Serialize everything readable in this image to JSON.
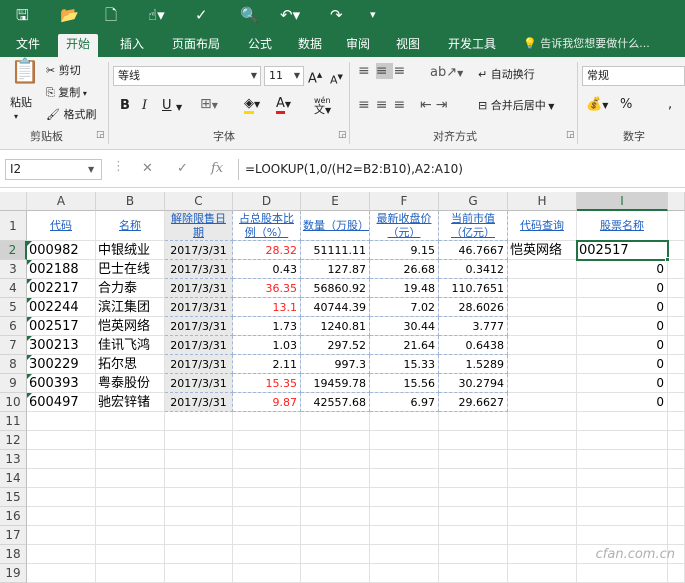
{
  "qat": {
    "icons": [
      "save-icon",
      "open-icon",
      "new-icon",
      "touch-icon",
      "spell-icon",
      "preview-icon",
      "undo-icon",
      "redo-icon",
      "customize-icon"
    ]
  },
  "tabs": [
    "文件",
    "开始",
    "插入",
    "页面布局",
    "公式",
    "数据",
    "审阅",
    "视图",
    "开发工具"
  ],
  "tellme": "告诉我您想要做什么...",
  "clipboard": {
    "cut": "剪切",
    "copy": "复制",
    "paste": "粘贴",
    "painter": "格式刷",
    "group": "剪贴板"
  },
  "font": {
    "name": "等线",
    "size": "11",
    "group": "字体",
    "bold": "B",
    "italic": "I",
    "underline": "U",
    "phonetic": "wén"
  },
  "alignment": {
    "wrap": "自动换行",
    "merge": "合并后居中",
    "group": "对齐方式"
  },
  "number": {
    "format": "常规",
    "group": "数字",
    "percent": "%"
  },
  "formula_bar": {
    "name_box": "I2",
    "fx": "fx",
    "formula": "=LOOKUP(1,0/(H2=B2:B10),A2:A10)"
  },
  "columns": [
    "A",
    "B",
    "C",
    "D",
    "E",
    "F",
    "G",
    "H",
    "I"
  ],
  "rows": [
    "1",
    "2",
    "3",
    "4",
    "5",
    "6",
    "7",
    "8",
    "9",
    "10",
    "11",
    "12",
    "13",
    "14",
    "15",
    "16",
    "17",
    "18",
    "19"
  ],
  "headers": [
    "代码",
    "名称",
    "解除限售日期",
    "占总股本比例（%）",
    "数量（万股）",
    "最新收盘价（元）",
    "当前市值（亿元）",
    "代码查询",
    "股票名称"
  ],
  "data": [
    [
      "000982",
      "中银绒业",
      "2017/3/31",
      "28.32",
      "51111.11",
      "9.15",
      "46.7667"
    ],
    [
      "002188",
      "巴士在线",
      "2017/3/31",
      "0.43",
      "127.87",
      "26.68",
      "0.3412"
    ],
    [
      "002217",
      "合力泰",
      "2017/3/31",
      "36.35",
      "56860.92",
      "19.48",
      "110.7651"
    ],
    [
      "002244",
      "滨江集团",
      "2017/3/31",
      "13.1",
      "40744.39",
      "7.02",
      "28.6026"
    ],
    [
      "002517",
      "恺英网络",
      "2017/3/31",
      "1.73",
      "1240.81",
      "30.44",
      "3.777"
    ],
    [
      "300213",
      "佳讯飞鸿",
      "2017/3/31",
      "1.03",
      "297.52",
      "21.64",
      "0.6438"
    ],
    [
      "300229",
      "拓尔思",
      "2017/3/31",
      "2.11",
      "997.3",
      "15.33",
      "1.5289"
    ],
    [
      "600393",
      "粤泰股份",
      "2017/3/31",
      "15.35",
      "19459.78",
      "15.56",
      "30.2794"
    ],
    [
      "600497",
      "驰宏锌锗",
      "2017/3/31",
      "9.87",
      "42557.68",
      "6.97",
      "29.6627"
    ]
  ],
  "red_rows": [
    0,
    2,
    3,
    7,
    8
  ],
  "lookup": {
    "h2": "恺英网络",
    "i2": "002517",
    "zeros": [
      "0",
      "0",
      "0",
      "0",
      "0",
      "0",
      "0",
      "0"
    ]
  },
  "watermark": "cfan.com.cn"
}
